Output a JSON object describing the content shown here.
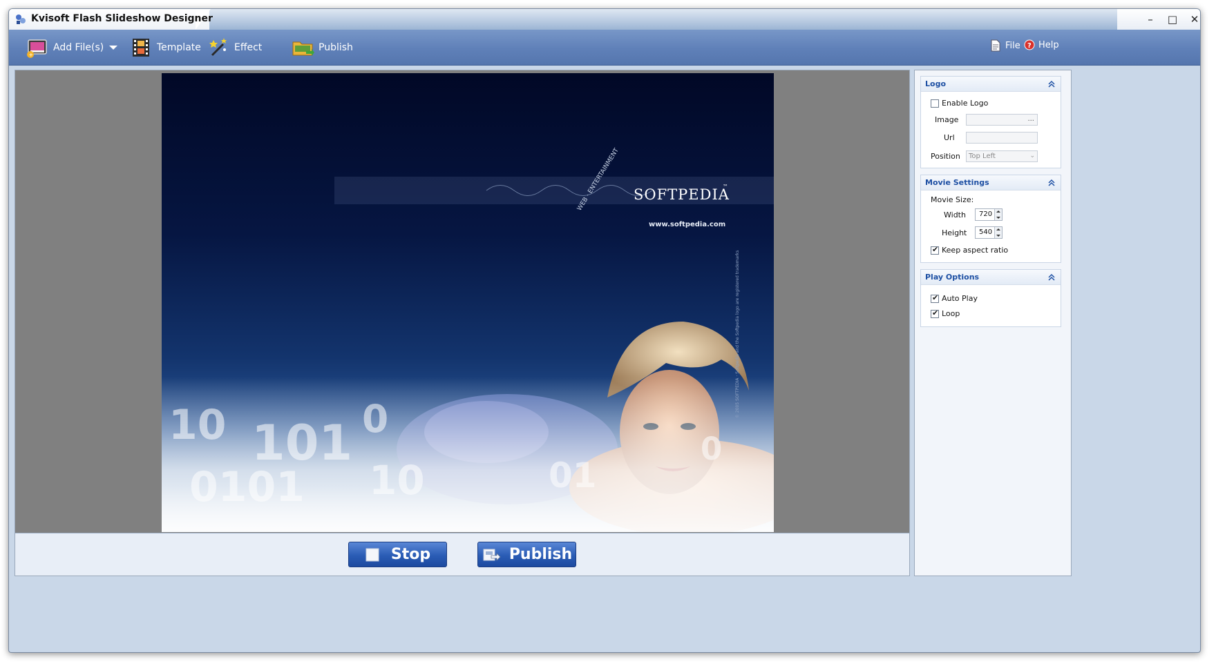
{
  "window": {
    "title": "Kvisoft Flash Slideshow Designer",
    "controls": [
      "–",
      "□",
      "✕"
    ]
  },
  "toolbar": {
    "add_files": "Add File(s)",
    "template": "Template",
    "effect": "Effect",
    "publish": "Publish",
    "file": "File",
    "help": "Help"
  },
  "preview": {
    "brand": "SOFTPEDIA",
    "tm": "™",
    "url": "www.softpedia.com",
    "tagline": "WEB · ENTERTAINMENT",
    "side_note": "© 2005 SOFTPEDIA · Softpedia and the Softpedia logo are registered trademarks"
  },
  "bottom": {
    "stop_label": "Stop",
    "publish_label": "Publish"
  },
  "panel": {
    "logo": {
      "header": "Logo",
      "enable_label": "Enable Logo",
      "enable_checked": false,
      "image_label": "Image",
      "image_value": "",
      "browse": "...",
      "url_label": "Url",
      "url_value": "",
      "position_label": "Position",
      "position_value": "Top Left"
    },
    "movie": {
      "header": "Movie Settings",
      "size_label": "Movie Size:",
      "width_label": "Width",
      "width_value": "720",
      "height_label": "Height",
      "height_value": "540",
      "keep_label": "Keep aspect ratio",
      "keep_checked": true
    },
    "play": {
      "header": "Play Options",
      "autoplay_label": "Auto Play",
      "autoplay_checked": true,
      "loop_label": "Loop",
      "loop_checked": true
    }
  },
  "colors": {
    "toolbar": "#5f80b8",
    "accent_text": "#1d4fa3",
    "button_blue": "#2a5cb5"
  }
}
